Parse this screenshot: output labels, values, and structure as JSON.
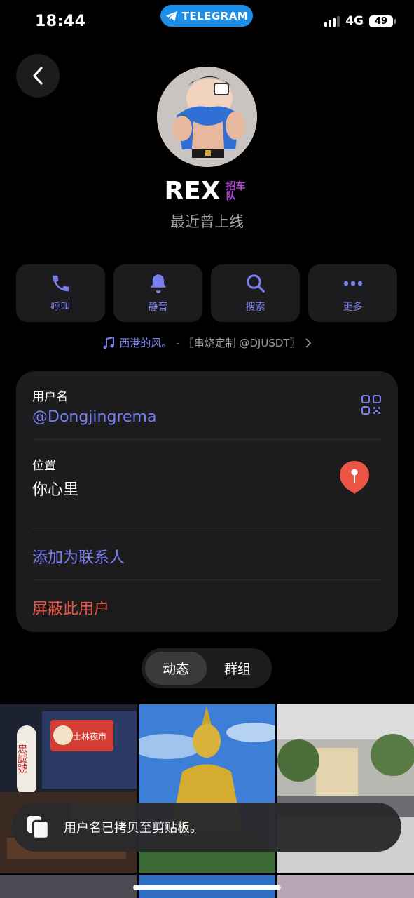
{
  "status_bar": {
    "time": "18:44",
    "app_pill": "TELEGRAM",
    "network": "4G",
    "battery": "49"
  },
  "profile": {
    "name": "REX",
    "badge": "招车队",
    "status": "最近曾上线"
  },
  "actions": [
    {
      "label": "呼叫",
      "icon": "phone-icon"
    },
    {
      "label": "静音",
      "icon": "bell-icon"
    },
    {
      "label": "搜索",
      "icon": "search-icon"
    },
    {
      "label": "更多",
      "icon": "more-icon"
    }
  ],
  "music": {
    "song": "西港的风。",
    "artist": "- 〖串烧定制 @DJUSDT〗"
  },
  "info": {
    "username_label": "用户名",
    "username_value": "@Dongjingrema",
    "location_label": "位置",
    "location_value": "你心里",
    "add_contact": "添加为联系人",
    "block_user": "屏蔽此用户"
  },
  "tabs": {
    "posts": "动态",
    "groups": "群组"
  },
  "media_signs": {
    "sign_1": "士林夜市",
    "sign_2": "忠誠號"
  },
  "toast": {
    "text": "用户名已拷贝至剪贴板。"
  },
  "colors": {
    "accent": "#7a7fef",
    "danger": "#eb5545",
    "card": "#1c1c1e",
    "pill": "#1d8fe8"
  }
}
